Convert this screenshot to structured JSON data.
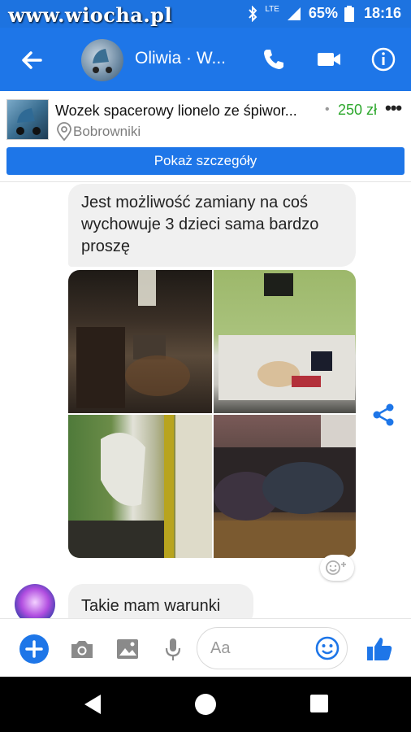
{
  "status_bar": {
    "watermark": "www.wiocha.pl",
    "network": "LTE",
    "battery": "65%",
    "time": "18:16"
  },
  "header": {
    "contact_name": "Oliwia · W..."
  },
  "listing": {
    "title": "Wozek spacerowy lionelo ze śpiwor...",
    "price": "250 zł",
    "location": "Bobrowniki",
    "details_button": "Pokaż szczegóły"
  },
  "messages": [
    {
      "text": "Jest możliwość zamiany na coś wychowuje 3 dzieci sama bardzo proszę"
    },
    {
      "text": "Takie mam warunki"
    }
  ],
  "composer": {
    "placeholder": "Aa"
  },
  "colors": {
    "brand": "#1e76e8",
    "price": "#2ea82e"
  }
}
